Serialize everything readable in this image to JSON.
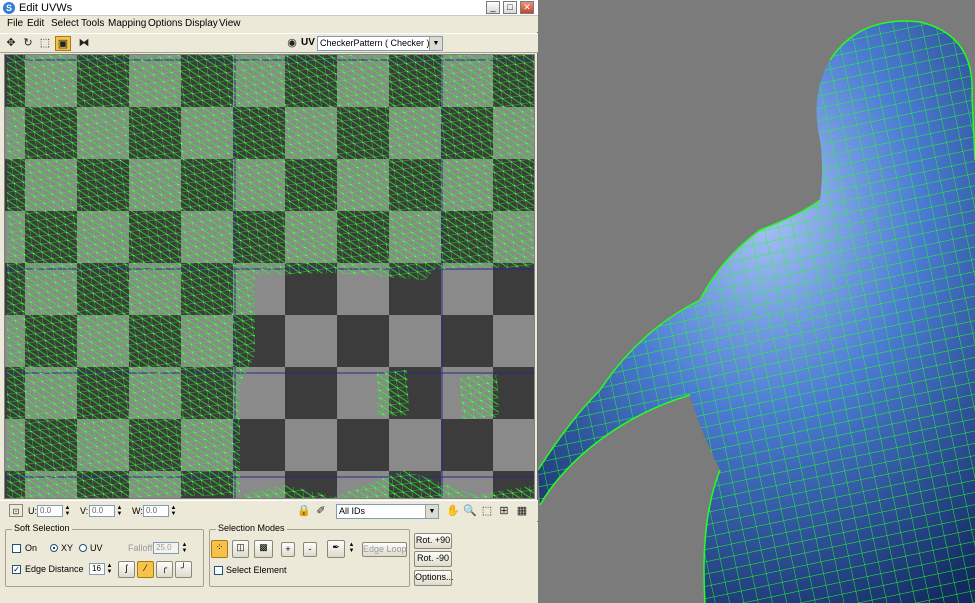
{
  "window": {
    "title": "Edit UVWs",
    "app_icon_glyph": "S",
    "controls": {
      "minimize": "_",
      "maximize": "□",
      "close": "✕"
    }
  },
  "menu": [
    "File",
    "Edit",
    "Select",
    "Tools",
    "Mapping",
    "Options",
    "Display",
    "View"
  ],
  "toolbar": {
    "tools": [
      "move-icon",
      "rotate-icon",
      "scale-icon",
      "freeform-icon",
      "mirror-icon"
    ],
    "uv_label": "UV",
    "texture_select": "CheckerPattern  ( Checker )"
  },
  "coords": {
    "u_label": "U:",
    "u_value": "0.0",
    "v_label": "V:",
    "v_value": "0.0",
    "w_label": "W:",
    "w_value": "0.0",
    "ids_select": "All IDs"
  },
  "soft_selection": {
    "title": "Soft Selection",
    "on_label": "On",
    "xy_label": "XY",
    "uv_label": "UV",
    "falloff_label": "Falloff:",
    "falloff_value": "25.0",
    "edge_distance_label": "Edge Distance",
    "edge_distance_value": "16",
    "edge_distance_checked": true
  },
  "selection_modes": {
    "title": "Selection Modes",
    "plus": "+",
    "minus": "-",
    "edge_loop": "Edge Loop",
    "select_element": "Select Element"
  },
  "actions": {
    "rot_plus": "Rot. +90",
    "rot_minus": "Rot. -90",
    "options": "Options..."
  },
  "colors": {
    "wire": "#22ff22",
    "checker_light": "#8a8a8a",
    "checker_dark": "#3c3c3c",
    "skin": "#3f70c8",
    "active_tool": "#f6c34a"
  }
}
